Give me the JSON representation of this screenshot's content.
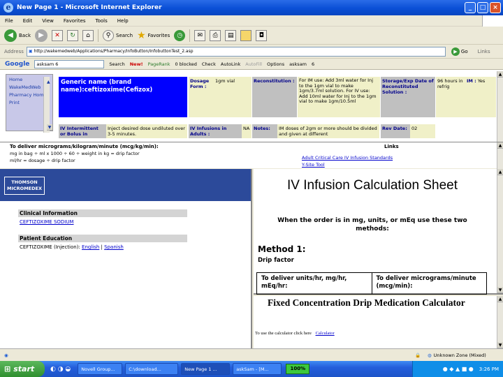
{
  "window": {
    "title": "New Page 1 - Microsoft Internet Explorer",
    "minimize": "_",
    "maximize": "□",
    "close": "×"
  },
  "menu": [
    "File",
    "Edit",
    "View",
    "Favorites",
    "Tools",
    "Help"
  ],
  "toolbar": {
    "back": "Back",
    "search": "Search",
    "favorites": "Favorites"
  },
  "address": {
    "label": "Address",
    "url": "http://wakemedweb/Applications/Pharmacy/InfoButton/InfobuttonTest_2.asp",
    "go": "Go",
    "links": "Links"
  },
  "google_bar": {
    "brand": "Google",
    "query": "asksam 6",
    "search": "Search",
    "new": "New!",
    "pagerank": "PageRank",
    "blocked": "0 blocked",
    "check": "Check",
    "autolink": "AutoLink",
    "autofill": "AutoFill",
    "options": "Options",
    "asksam": "asksam",
    "six": "6"
  },
  "nav": [
    "Home",
    "WakeMedWeb",
    "Pharmacy Home",
    "Print"
  ],
  "drug_table": {
    "generic_name": "Generic name (brand name):ceftizoxime(Cefizox)",
    "dosage_form_label": "Dosage Form :",
    "dosage_form_value": "1gm vial",
    "reconstitution_label": "Reconstitution :",
    "reconstitution_value": "For IM use: Add 3ml water for Inj to the 1gm vial to make 1gm/3.7ml solution. For IV use: Add 10ml water for Inj to the 1gm vial to make 1gm/10.5ml",
    "storage_label": "Storage/Exp Date of Reconstituted Solution :",
    "storage_value": "96 hours in refrig",
    "im_label": "IM :",
    "im_value": "Yes",
    "iv_intermittent_label": "IV Intermittent or Bolus in",
    "iv_intermittent_value": "Inject desired dose undiluted over 3-5 minutes.",
    "iv_infusions_label": "IV Infusions in Adults :",
    "iv_infusions_value": "NA",
    "notes_label": "Notes:",
    "notes_value": "IM doses of 2gm or more should be divided and given at different",
    "rev_date_label": "Rev Date:",
    "rev_date_value": "02"
  },
  "formula": {
    "heading": "To deliver micrograms/kilogram/minute (mcg/kg/min):",
    "line1": "mg in bag ÷ ml x 1000 ÷ 60 ÷ weight in kg = drip factor",
    "line2": "ml/hr = dosage ÷ drip factor",
    "links_heading": "Links",
    "link1": "Adult Critical Care IV Infusion Standards",
    "link2": "Y-Site Tool"
  },
  "micromedex": {
    "logo_top": "THOMSON",
    "logo_bottom": "MICROMEDEX",
    "clinical_heading": "Clinical Information",
    "clinical_link": "CEFTIZOXIME SODIUM",
    "patient_heading": "Patient Education",
    "patient_text": "CEFTIZOXIME (Injection):",
    "english": "English",
    "divider": "|",
    "spanish": "Spanish"
  },
  "calc_sheet": {
    "title": "IV Infusion Calculation Sheet",
    "subtitle": "When the order is in mg, units, or mEq use these two methods:",
    "method": "Method 1:",
    "method_sub": "Drip factor",
    "col1": "To deliver units/hr, mg/hr, mEq/hr:",
    "col2": "To deliver micrograms/minute (mcg/min):"
  },
  "fixed_calc": {
    "title": "Fixed Concentration Drip Medication Calculator",
    "text": "To use the calculator click here",
    "link": "Calculator"
  },
  "status": {
    "zone": "Unknown Zone (Mixed)"
  },
  "taskbar": {
    "start": "start",
    "tasks": [
      "Novell Group...",
      "C:\\download...",
      "New Page 1 ...",
      "askSam - [M..."
    ],
    "zoom": "100%",
    "time": "3:26 PM"
  }
}
